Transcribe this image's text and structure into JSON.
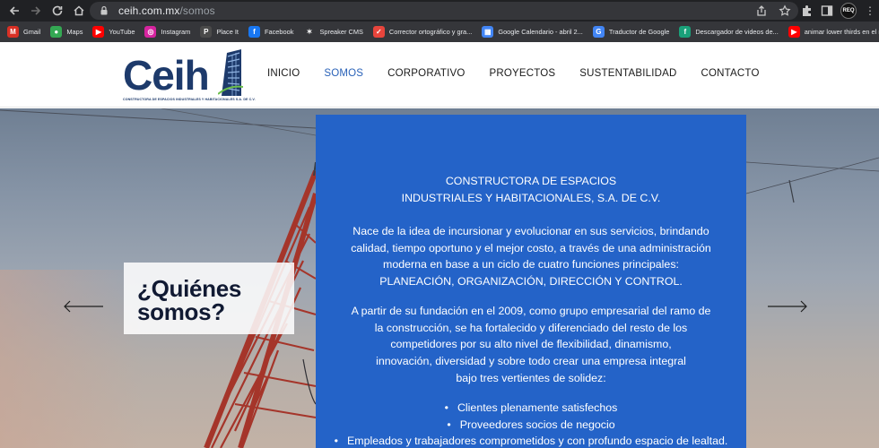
{
  "browser": {
    "url_host": "ceih.com.mx",
    "url_path": "/somos",
    "profile_initials": "REQ",
    "bookmarks": [
      {
        "label": "Gmail",
        "icon": "gmail-icon",
        "color": "#d93025",
        "glyph": "M"
      },
      {
        "label": "Maps",
        "icon": "maps-icon",
        "color": "#34a853",
        "glyph": "●"
      },
      {
        "label": "YouTube",
        "icon": "youtube-icon",
        "color": "#ff0000",
        "glyph": "▶"
      },
      {
        "label": "Instagram",
        "icon": "instagram-icon",
        "color": "#d6249f",
        "glyph": "◎"
      },
      {
        "label": "Place It",
        "icon": "placeit-icon",
        "color": "#4a4a4a",
        "glyph": "P"
      },
      {
        "label": "Facebook",
        "icon": "facebook-icon",
        "color": "#1877f2",
        "glyph": "f"
      },
      {
        "label": "Spreaker CMS",
        "icon": "spreaker-icon",
        "color": "#35363a",
        "glyph": "✶"
      },
      {
        "label": "Corrector ortográfico y gra...",
        "icon": "corrector-icon",
        "color": "#e8453c",
        "glyph": "✓"
      },
      {
        "label": "Google Calendario - abril 2...",
        "icon": "calendar-icon",
        "color": "#4285f4",
        "glyph": "▦"
      },
      {
        "label": "Traductor de Google",
        "icon": "translate-icon",
        "color": "#4285f4",
        "glyph": "G"
      },
      {
        "label": "Descargador de videos de...",
        "icon": "downloader-icon",
        "color": "#1aa17a",
        "glyph": "f"
      },
      {
        "label": "animar lower thirds en el n...",
        "icon": "youtube-icon",
        "color": "#ff0000",
        "glyph": "▶"
      }
    ]
  },
  "site": {
    "logo_text": "Ceih",
    "logo_subtitle": "CONSTRUCTORA DE ESPACIOS INDUSTRIALES Y HABITACIONALES S.A. DE C.V.",
    "nav": [
      {
        "label": "INICIO",
        "active": false
      },
      {
        "label": "SOMOS",
        "active": true
      },
      {
        "label": "CORPORATIVO",
        "active": false
      },
      {
        "label": "PROYECTOS",
        "active": false
      },
      {
        "label": "SUSTENTABILIDAD",
        "active": false
      },
      {
        "label": "CONTACTO",
        "active": false
      }
    ]
  },
  "hero": {
    "heading_line1": "¿Quiénes",
    "heading_line2": "somos?",
    "panel": {
      "title_line1": "CONSTRUCTORA DE ESPACIOS",
      "title_line2": "INDUSTRIALES Y HABITACIONALES, S.A. DE C.V.",
      "p1": [
        "Nace de la idea de incursionar y evolucionar en sus servicios, brindando",
        "calidad, tiempo oportuno y el mejor costo, a través de una administración",
        "moderna en base a un ciclo de cuatro funciones principales:",
        "PLANEACIÓN, ORGANIZACIÓN, DIRECCIÓN Y CONTROL."
      ],
      "p2": [
        "A partir de su fundación en el 2009, como grupo empresarial del ramo de",
        "la construcción, se ha fortalecido y diferenciado del resto de los",
        "competidores por su alto nivel de flexibilidad, dinamismo,",
        "innovación, diversidad y sobre todo crear una empresa integral",
        "bajo tres vertientes de solidez:"
      ],
      "list": [
        "Clientes plenamente satisfechos",
        "Proveedores socios de negocio",
        "Empleados y trabajadores comprometidos y con profundo espacio de lealtad."
      ]
    }
  },
  "colors": {
    "brand_navy": "#1d3a6b",
    "nav_active": "#2a62b8",
    "panel_blue": "#2463c8",
    "crane_red": "#a5352a"
  }
}
